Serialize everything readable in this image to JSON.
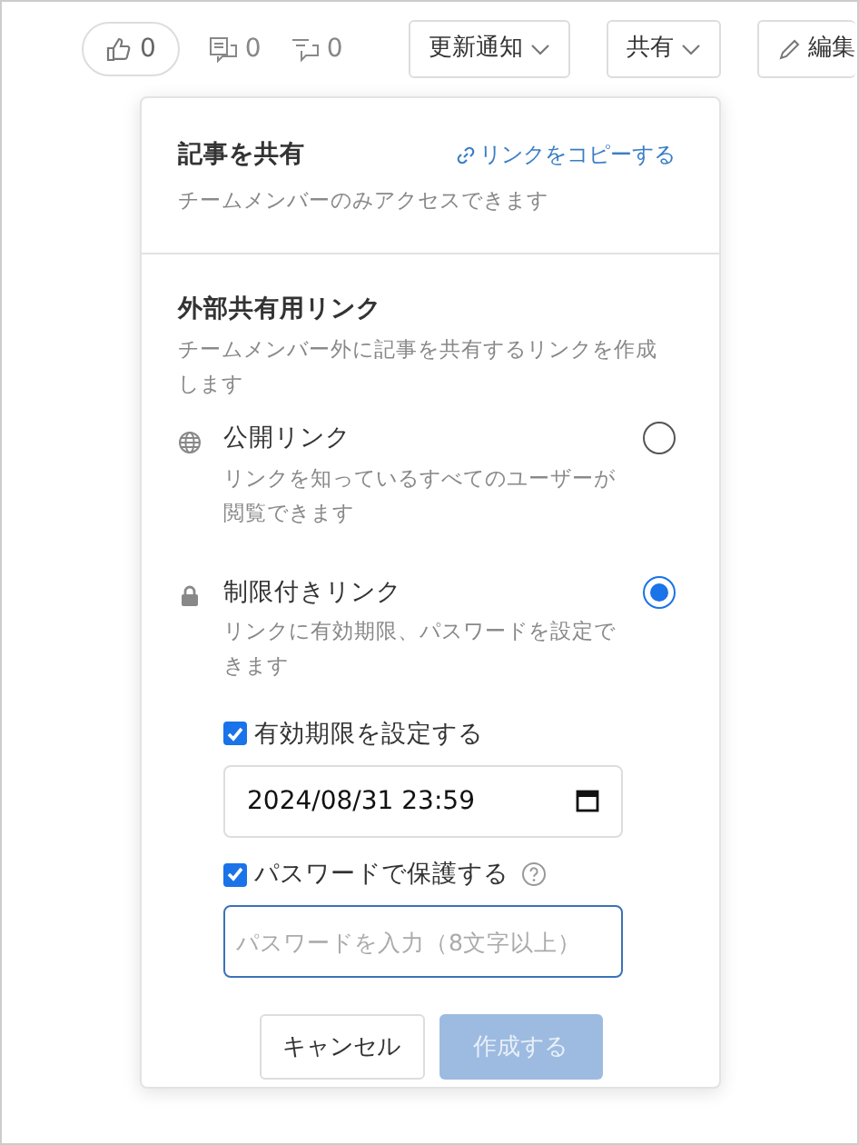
{
  "toolbar": {
    "like_count": "0",
    "comment_count": "0",
    "reply_count": "0",
    "buttons": [
      {
        "kind": "dropdown",
        "label": "更新通知"
      },
      {
        "kind": "dropdown",
        "label": "共有"
      },
      {
        "kind": "edit",
        "label": "編集"
      }
    ]
  },
  "share_popover": {
    "title": "記事を共有",
    "copy_link": "リンクをコピーする",
    "subtitle": "チームメンバーのみアクセスできます",
    "external": {
      "heading": "外部共有用リンク",
      "description": "チームメンバー外に記事を共有するリンクを作成します",
      "options": [
        {
          "kind": "public",
          "label": "公開リンク",
          "description": "リンクを知っているすべてのユーザーが閲覧できます",
          "selected": false
        },
        {
          "kind": "restricted",
          "label": "制限付きリンク",
          "description": "リンクに有効期限、パスワードを設定できます",
          "selected": true
        }
      ]
    },
    "expiry": {
      "label": "有効期限を設定する",
      "checked": true,
      "value": "2024/08/31 23:59"
    },
    "password": {
      "label": "パスワードで保護する",
      "checked": true,
      "help": true,
      "placeholder": "パスワードを入力（8文字以上）",
      "focused": true
    },
    "cancel": "キャンセル",
    "create": {
      "label": "作成する",
      "disabled": true
    }
  }
}
